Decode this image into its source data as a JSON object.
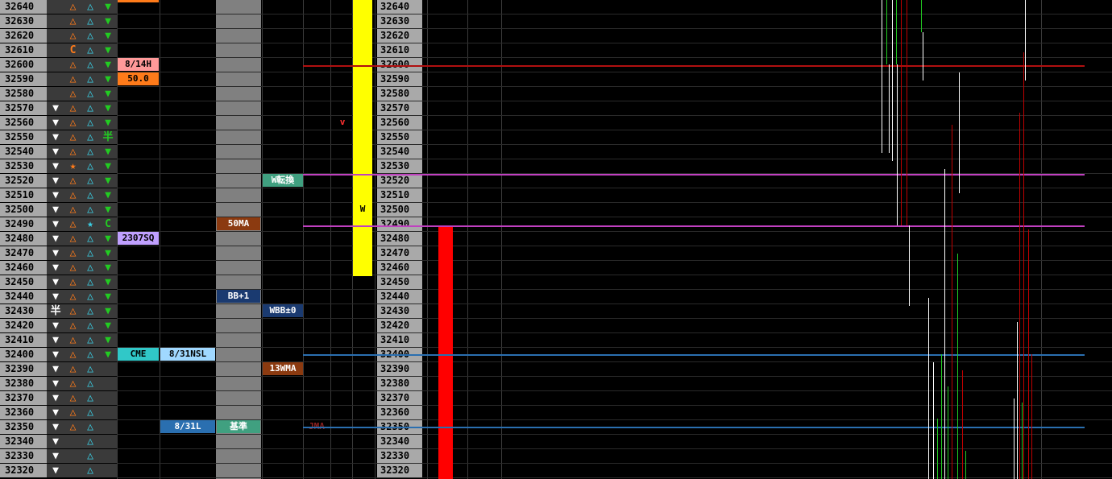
{
  "prices": [
    "32640",
    "32630",
    "32620",
    "32610",
    "32600",
    "32590",
    "32580",
    "32570",
    "32560",
    "32550",
    "32540",
    "32530",
    "32520",
    "32510",
    "32500",
    "32490",
    "32480",
    "32470",
    "32460",
    "32450",
    "32440",
    "32430",
    "32420",
    "32410",
    "32400",
    "32390",
    "32380",
    "32370",
    "32360",
    "32350",
    "32340",
    "32330",
    "32320"
  ],
  "col1": [
    "",
    "",
    "",
    "",
    "",
    "",
    "",
    "down",
    "down",
    "down",
    "down",
    "down",
    "down",
    "down",
    "down",
    "down",
    "down",
    "down",
    "down",
    "down",
    "down",
    "half",
    "down",
    "down",
    "down",
    "down",
    "down",
    "down",
    "down",
    "down",
    "down",
    "down",
    "down"
  ],
  "col2": [
    "tri",
    "tri",
    "tri",
    "C",
    "tri",
    "tri",
    "tri",
    "tri",
    "tri",
    "tri",
    "tri",
    "star",
    "tri",
    "tri",
    "tri",
    "tri",
    "tri",
    "tri",
    "tri",
    "tri",
    "tri",
    "tri",
    "tri",
    "tri",
    "tri",
    "tri",
    "tri",
    "tri",
    "tri",
    "tri",
    "",
    "",
    ""
  ],
  "col3": [
    "tri",
    "tri",
    "tri",
    "tri",
    "tri",
    "tri",
    "tri",
    "tri",
    "tri",
    "tri",
    "tri",
    "tri",
    "tri",
    "tri",
    "tri",
    "star",
    "tri",
    "tri",
    "tri",
    "tri",
    "tri",
    "tri",
    "tri",
    "tri",
    "tri",
    "tri",
    "tri",
    "tri",
    "tri",
    "tri",
    "tri",
    "tri",
    "tri"
  ],
  "col4": [
    "down",
    "down",
    "down",
    "down",
    "down",
    "down",
    "down",
    "down",
    "down",
    "half",
    "down",
    "down",
    "down",
    "down",
    "down",
    "C",
    "down",
    "down",
    "down",
    "down",
    "down",
    "down",
    "down",
    "down",
    "down",
    "",
    "",
    "",
    "",
    "",
    "",
    "",
    ""
  ],
  "symbols": {
    "down": "▼",
    "tri": "△",
    "star": "★",
    "C": "C",
    "half": "半"
  },
  "symbol_colors": {
    "col1": "#ffffff",
    "col2": "#ff7b1a",
    "col3": "#3ad0e6",
    "col4": "#22cc22",
    "half_col1": "#ffffff",
    "half_col4": "#22cc22",
    "star_col2": "#ff7b1a",
    "star_col3": "#3ad0e6",
    "C_col2": "#ff7b1a",
    "C_col4": "#22cc22"
  },
  "labels": {
    "d814h": "8/14H",
    "v500": "50.0",
    "sq2307": "2307SQ",
    "cme": "CME",
    "nsl831": "8/31NSL",
    "l831": "8/31L",
    "kijun": "基準",
    "ma50": "50MA",
    "bbp1": "BB+1",
    "wtenkan": "W転換",
    "wbb0": "WBB±0",
    "wma13": "13WMA",
    "jma": "JMA",
    "v_mark": "v",
    "w_mark": "W"
  },
  "colors": {
    "accent_red": "#ff0000",
    "magenta": "#c040c0",
    "blue_line": "#2a6fb0",
    "yellow": "#ffff00",
    "gray_panel": "#808080"
  }
}
